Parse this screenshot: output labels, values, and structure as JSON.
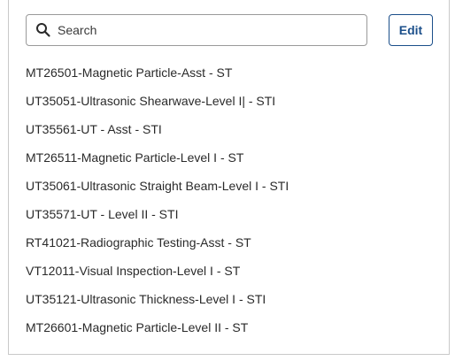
{
  "search": {
    "placeholder": "Search",
    "icon": "search-icon"
  },
  "toolbar": {
    "edit_label": "Edit"
  },
  "items": [
    "MT26501-Magnetic Particle-Asst - ST",
    "UT35051-Ultrasonic Shearwave-Level I| - STI",
    "UT35561-UT - Asst - STI",
    "MT26511-Magnetic Particle-Level I - ST",
    "UT35061-Ultrasonic Straight Beam-Level I - STI",
    "UT35571-UT - Level II - STI",
    "RT41021-Radiographic Testing-Asst - ST",
    "VT12011-Visual Inspection-Level I - ST",
    "UT35121-Ultrasonic Thickness-Level I - STI",
    "MT26601-Magnetic Particle-Level II - ST"
  ],
  "colors": {
    "accent": "#1b4f8a",
    "border": "#c9c9c9",
    "text": "#2a2a2a"
  }
}
